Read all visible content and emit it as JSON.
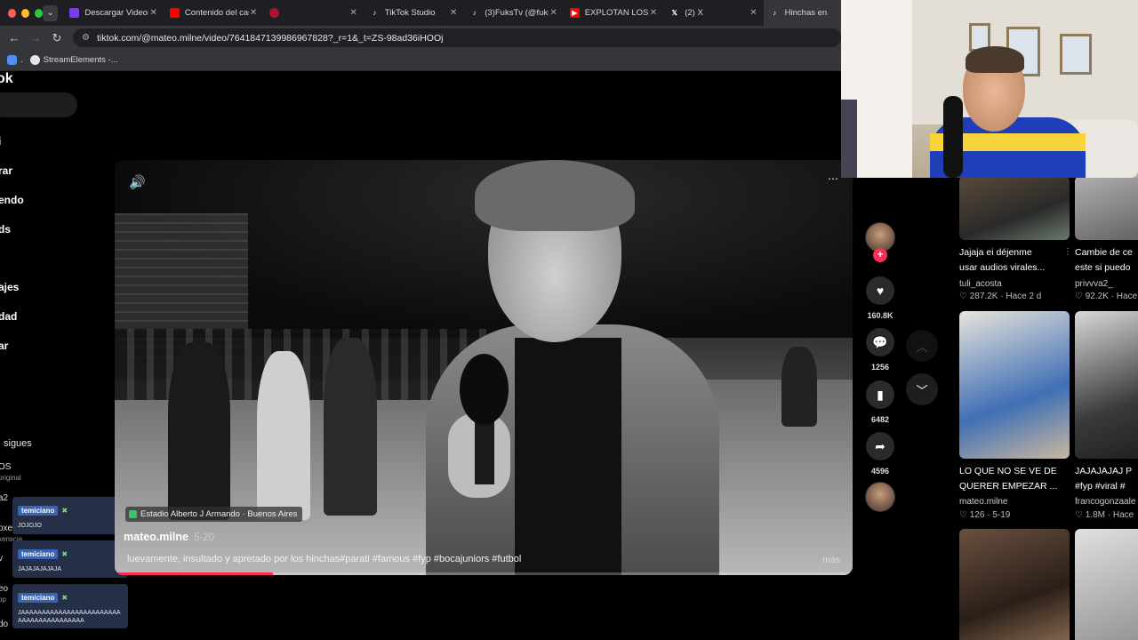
{
  "browser": {
    "tabs": [
      {
        "title": "Descargar Videos",
        "fav_color": "#7a3cf0"
      },
      {
        "title": "Contenido del can",
        "fav_color": "#ff0000"
      },
      {
        "title": "",
        "fav_color": "#b01030"
      },
      {
        "title": "TikTok Studio",
        "fav_color": "#111111"
      },
      {
        "title": "(3)FuksTv (@fuks",
        "fav_color": "#111111"
      },
      {
        "title": "EXPLOTAN LOS H",
        "fav_color": "#ff0000"
      },
      {
        "title": "(2) X",
        "fav_color": "#111111"
      },
      {
        "title": "Hinchas en",
        "fav_color": "#111111"
      }
    ],
    "url": "tiktok.com/@mateo.milne/video/7641847139986967828?_r=1&_t=ZS-98ad36iHOOj",
    "bookmarks": [
      "StreamElements -..."
    ]
  },
  "sidebar": {
    "logo": "ok",
    "nav": [
      "i",
      "rar",
      "endo",
      "ds",
      "ajes",
      "dad",
      "ar"
    ],
    "following_header": "sigues",
    "accounts": [
      {
        "name": "OS",
        "sub": "original"
      },
      {
        "name": "a2",
        "sub": "asla"
      },
      {
        "name": "oxe",
        "sub": "xenscia"
      },
      {
        "name": "v",
        "sub": ""
      },
      {
        "name": "eo",
        "sub": "op"
      },
      {
        "name": "do",
        "sub": ""
      }
    ]
  },
  "chat": [
    {
      "user": "temiciano",
      "text": "JOJOJO"
    },
    {
      "user": "temiciano",
      "text": "JAJAJAJAJAJA"
    },
    {
      "user": "temiciano",
      "text": "JAAAAAAAAAAAAAAAAAAAAAAAAAAAAAAAAAAAAAAAA"
    }
  ],
  "video": {
    "location": "Estadio Alberto J Armando · Buenos Aires",
    "author": "mateo.milne",
    "date": "5-20",
    "caption": "luevamente, insultado y apretado por los hinchas#parati #famous #fyp #bocajuniors #futbol",
    "more": "más",
    "progress": 0.215
  },
  "actions": {
    "likes": "160.8K",
    "comments": "1256",
    "saves": "6482",
    "shares": "4596"
  },
  "recs": [
    {
      "title1": "Jajaja ei déjenme",
      "title2": "usar audios virales...",
      "user": "tuli_acosta",
      "views": "287.2K",
      "when": "Hace 2 d"
    },
    {
      "title1": "Cambie de ce",
      "title2": "este si puedo",
      "user": "privvva2_",
      "views": "92.2K",
      "when": "Hace"
    },
    {
      "title1": "LO QUE NO SE VE DE",
      "title2": "QUERER EMPEZAR ...",
      "user": "mateo.milne",
      "views": "126",
      "when": "5-19"
    },
    {
      "title1": "JAJAJAJAJ P",
      "title2": "#fyp #viral #",
      "user": "francogonzaale",
      "views": "1.8M",
      "when": "Hace"
    }
  ],
  "colors": {
    "accent": "#fe2c55",
    "bg": "#000000",
    "tabbar": "#1f1f23"
  },
  "icons": [
    "volume-icon",
    "heart-icon",
    "comment-icon",
    "bookmark-icon",
    "share-icon",
    "chevron-up-icon",
    "chevron-down-icon"
  ]
}
